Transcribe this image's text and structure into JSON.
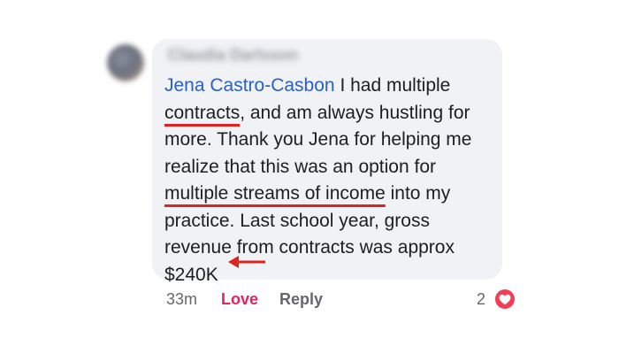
{
  "comment": {
    "author": "Claudia Darlsson",
    "mention": "Jena Castro-Casbon",
    "lines": {
      "l1_after_mention": " I had multiple",
      "l2_underlined": "contracts",
      "l2_rest": ", and am always hustling for",
      "l3": "more. Thank you Jena for helping me",
      "l4": "realize that this was an option for",
      "l5_underlined": "multiple streams of income",
      "l5_rest": " into my",
      "l6": "practice. Last school year, gross",
      "l7": "revenue from contracts was approx",
      "l8": "$240K"
    }
  },
  "actions": {
    "time": "33m",
    "love_label": "Love",
    "reply_label": "Reply",
    "reaction_count": "2",
    "reaction_icon": "heart-icon"
  },
  "colors": {
    "mention": "#2a60c7",
    "annotation_red": "#e0221c",
    "love": "#e0245e",
    "bubble": "#f0f2f5"
  }
}
